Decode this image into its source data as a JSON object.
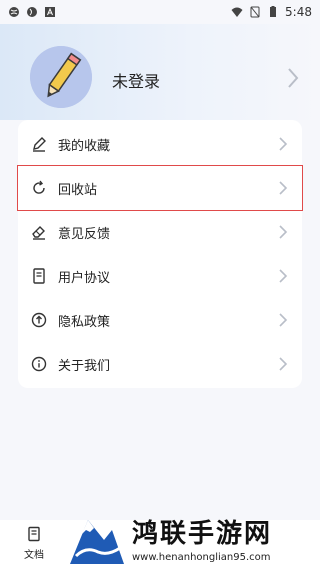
{
  "status_bar": {
    "time": "5:48",
    "icons": [
      "globe-icon",
      "globe-icon",
      "a-icon",
      "wifi-icon",
      "no-sim-icon",
      "battery-icon"
    ]
  },
  "profile": {
    "login_text": "未登录",
    "avatar_icon": "pencil-icon"
  },
  "menu": {
    "items": [
      {
        "label": "我的收藏",
        "icon": "pen-icon"
      },
      {
        "label": "回收站",
        "icon": "refresh-icon"
      },
      {
        "label": "意见反馈",
        "icon": "eraser-icon"
      },
      {
        "label": "用户协议",
        "icon": "document-icon"
      },
      {
        "label": "隐私政策",
        "icon": "arrow-up-circle-icon"
      },
      {
        "label": "关于我们",
        "icon": "info-icon"
      }
    ]
  },
  "bottom_nav": {
    "doc_label": "文档"
  },
  "watermark": {
    "title": "鸿联手游网",
    "url": "www.henanhonglian95.com"
  }
}
